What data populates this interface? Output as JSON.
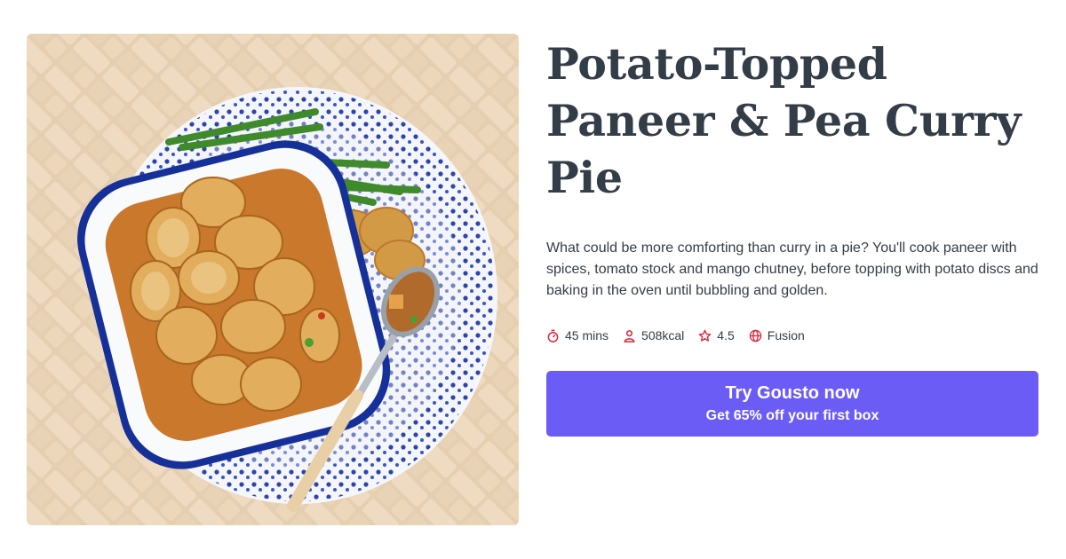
{
  "recipe": {
    "title": "Potato-Topped Paneer & Pea Curry Pie",
    "description": "What could be more comforting than curry in a pie? You'll cook paneer with spices, tomato stock and mango chutney, before topping with potato discs and baking in the oven until bubbling and golden.",
    "meta": {
      "time": "45 mins",
      "calories": "508kcal",
      "rating": "4.5",
      "cuisine": "Fusion"
    },
    "icons": [
      "stopwatch-icon",
      "person-icon",
      "star-icon",
      "globe-icon"
    ]
  },
  "cta": {
    "title": "Try Gousto now",
    "subtitle": "Get 65% off your first box"
  },
  "colors": {
    "accent": "#6b5cf6",
    "icon": "#e0233b",
    "text": "#333d47"
  }
}
